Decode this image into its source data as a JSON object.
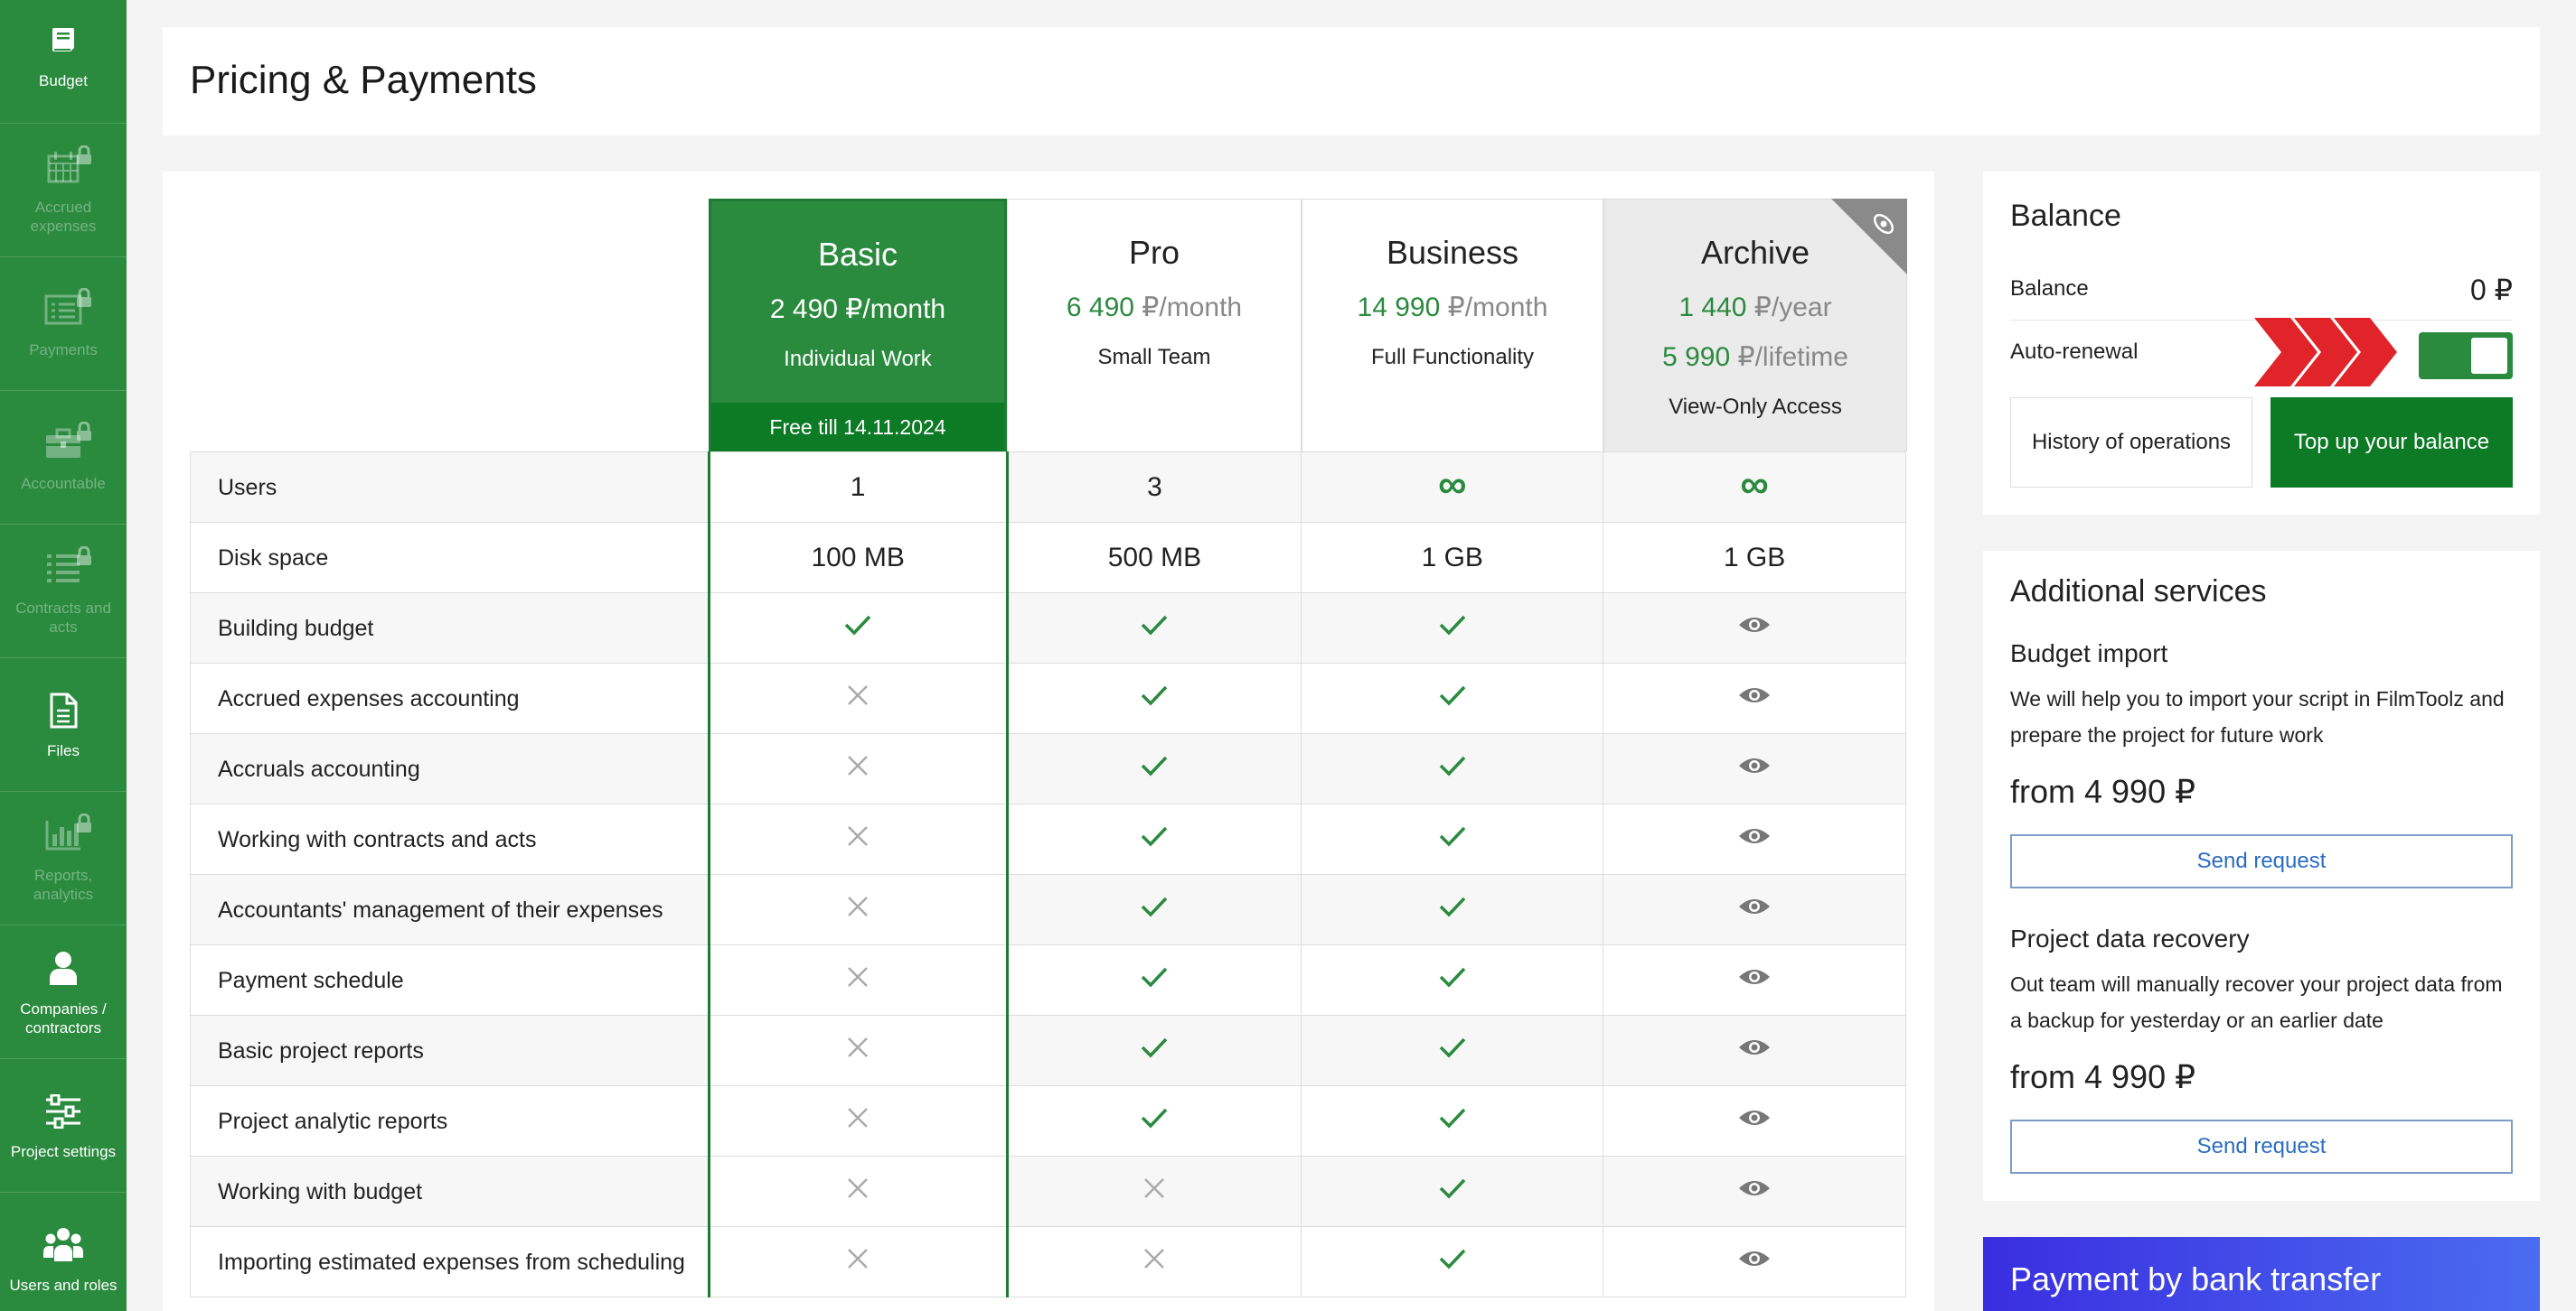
{
  "sidebar": {
    "items": [
      {
        "label": "Budget",
        "icon": "book-icon",
        "locked": false
      },
      {
        "label": "Accrued expenses",
        "icon": "calendar-icon",
        "locked": true
      },
      {
        "label": "Payments",
        "icon": "payments-icon",
        "locked": true
      },
      {
        "label": "Accountable",
        "icon": "briefcase-icon",
        "locked": true
      },
      {
        "label": "Contracts and acts",
        "icon": "list-icon",
        "locked": true
      },
      {
        "label": "Files",
        "icon": "file-icon",
        "locked": false
      },
      {
        "label": "Reports, analytics",
        "icon": "bar-chart-icon",
        "locked": true
      },
      {
        "label": "Companies / contractors",
        "icon": "person-icon",
        "locked": false
      },
      {
        "label": "Project settings",
        "icon": "sliders-icon",
        "locked": false
      },
      {
        "label": "Users and roles",
        "icon": "users-icon",
        "locked": false
      }
    ]
  },
  "header": {
    "title": "Pricing & Payments"
  },
  "plans": [
    {
      "name": "Basic",
      "price_num": "2 490",
      "price_unit": " ₽/month",
      "subtitle": "Individual Work",
      "badge": "Free till 14.11.2024"
    },
    {
      "name": "Pro",
      "price_num": "6 490",
      "price_unit": " ₽/month",
      "subtitle": "Small Team"
    },
    {
      "name": "Business",
      "price_num": "14 990",
      "price_unit": " ₽/month",
      "subtitle": "Full Functionality"
    },
    {
      "name": "Archive",
      "price_num": "1 440",
      "price_unit": " ₽/year",
      "price2_num": "5 990",
      "price2_unit": " ₽/lifetime",
      "subtitle": "View-Only Access"
    }
  ],
  "features": [
    {
      "name": "Users",
      "values": [
        "1",
        "3",
        "infinity",
        "infinity"
      ]
    },
    {
      "name": "Disk space",
      "values": [
        "100 MB",
        "500 MB",
        "1 GB",
        "1 GB"
      ]
    },
    {
      "name": "Building budget",
      "values": [
        "check",
        "check",
        "check",
        "view"
      ]
    },
    {
      "name": "Accrued expenses accounting",
      "values": [
        "cross",
        "check",
        "check",
        "view"
      ]
    },
    {
      "name": "Accruals accounting",
      "values": [
        "cross",
        "check",
        "check",
        "view"
      ]
    },
    {
      "name": "Working with contracts and acts",
      "values": [
        "cross",
        "check",
        "check",
        "view"
      ]
    },
    {
      "name": "Accountants' management of their expenses",
      "values": [
        "cross",
        "check",
        "check",
        "view"
      ]
    },
    {
      "name": "Payment schedule",
      "values": [
        "cross",
        "check",
        "check",
        "view"
      ]
    },
    {
      "name": "Basic project reports",
      "values": [
        "cross",
        "check",
        "check",
        "view"
      ]
    },
    {
      "name": "Project analytic reports",
      "values": [
        "cross",
        "check",
        "check",
        "view"
      ]
    },
    {
      "name": "Working with budget",
      "values": [
        "cross",
        "cross",
        "check",
        "view"
      ]
    },
    {
      "name": "Importing estimated expenses from scheduling",
      "values": [
        "cross",
        "cross",
        "check",
        "view"
      ]
    }
  ],
  "balance": {
    "title": "Balance",
    "balance_label": "Balance",
    "balance_value": "0 ₽",
    "autorenewal_label": "Auto-renewal",
    "autorenewal_on": true,
    "history_button": "History of operations",
    "topup_button": "Top up your balance"
  },
  "services": {
    "title": "Additional services",
    "items": [
      {
        "name": "Budget import",
        "description": "We will help you to import your script in FilmToolz and prepare the project for future work",
        "price": "from 4 990 ₽",
        "button": "Send request"
      },
      {
        "name": "Project data recovery",
        "description": "Out team will manually recover your project data from a backup for yesterday or an earlier date",
        "price": "from 4 990 ₽",
        "button": "Send request"
      }
    ]
  },
  "bank": {
    "title": "Payment by bank transfer"
  },
  "colors": {
    "accent_green": "#2a8a3e",
    "dark_green": "#0d7a25",
    "cross_grey": "#aaaaaa",
    "eye_grey": "#777777",
    "arrow_red": "#e0242a",
    "link_blue": "#2b6cc4"
  }
}
